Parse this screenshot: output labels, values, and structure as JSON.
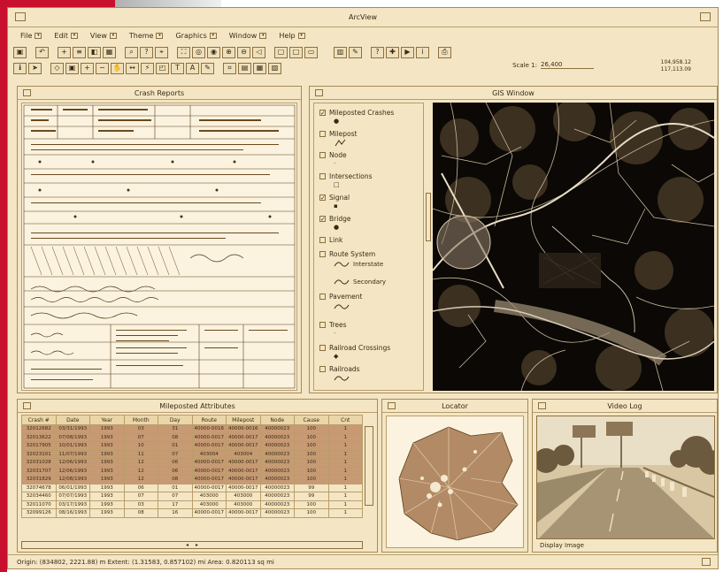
{
  "app": {
    "title": "ArcView",
    "menus": [
      "File",
      "Edit",
      "View",
      "Theme",
      "Graphics",
      "Window",
      "Help"
    ],
    "zoom_label": "Scale 1:",
    "zoom_value": "26,400",
    "coords_line1": "104,958.12",
    "coords_line2": "117,113.09"
  },
  "crash_panel": {
    "title": "Crash Reports"
  },
  "gis_panel": {
    "title": "GIS Window",
    "legend": [
      {
        "label": "Mileposted Crashes",
        "checked": true
      },
      {
        "label": "Milepost",
        "checked": false
      },
      {
        "label": "Node",
        "checked": false
      },
      {
        "label": "Intersections",
        "checked": false
      },
      {
        "label": "Signal",
        "checked": true
      },
      {
        "label": "Bridge",
        "checked": true
      },
      {
        "label": "Link",
        "checked": false
      },
      {
        "label": "Route System",
        "checked": false
      },
      {
        "label": "Interstate",
        "checked": false
      },
      {
        "label": "Secondary",
        "checked": false
      },
      {
        "label": "Pavement",
        "checked": false
      },
      {
        "label": "Trees",
        "checked": false
      },
      {
        "label": "Railroad Crossings",
        "checked": false
      },
      {
        "label": "Railroads",
        "checked": false
      }
    ]
  },
  "attributes_panel": {
    "title": "Mileposted Attributes",
    "columns": [
      "Crash #",
      "Date",
      "Year",
      "Month",
      "Day",
      "Route",
      "Milepost",
      "Node",
      "Cause",
      "Cnt"
    ],
    "rows": [
      [
        "32012682",
        "03/31/1993",
        "1993",
        "03",
        "31",
        "40000-0016",
        "40000-0016",
        "40000023",
        "100",
        "1"
      ],
      [
        "32013622",
        "07/08/1993",
        "1993",
        "07",
        "08",
        "40000-0017",
        "40000-0017",
        "40000023",
        "100",
        "1"
      ],
      [
        "32017905",
        "10/01/1993",
        "1993",
        "10",
        "01",
        "40000-0017",
        "40000-0017",
        "40000023",
        "100",
        "1"
      ],
      [
        "32023101",
        "11/07/1993",
        "1993",
        "11",
        "07",
        "403004",
        "403004",
        "40000023",
        "100",
        "1"
      ],
      [
        "32031028",
        "12/06/1993",
        "1993",
        "12",
        "06",
        "40000-0017",
        "40000-0017",
        "40000023",
        "100",
        "1"
      ],
      [
        "32031707",
        "12/06/1993",
        "1993",
        "12",
        "06",
        "40000-0017",
        "40000-0017",
        "40000023",
        "100",
        "1"
      ],
      [
        "32031829",
        "12/08/1993",
        "1993",
        "12",
        "08",
        "40000-0017",
        "40000-0017",
        "40000023",
        "100",
        "1"
      ],
      [
        "32074678",
        "06/01/1993",
        "1993",
        "06",
        "01",
        "40000-0017",
        "40000-0017",
        "40000023",
        "99",
        "1"
      ],
      [
        "32034460",
        "07/07/1993",
        "1993",
        "07",
        "07",
        "403000",
        "403000",
        "40000023",
        "99",
        "1"
      ],
      [
        "32011070",
        "03/17/1993",
        "1993",
        "03",
        "17",
        "403000",
        "403000",
        "40000023",
        "100",
        "1"
      ],
      [
        "32099126",
        "08/16/1993",
        "1993",
        "08",
        "16",
        "40000-0017",
        "40000-0017",
        "40000023",
        "100",
        "1"
      ]
    ],
    "highlighted_rows": [
      0,
      1,
      2,
      3,
      4,
      5,
      6
    ]
  },
  "locator_panel": {
    "title": "Locator"
  },
  "video_panel": {
    "title": "Video Log",
    "caption": "Display Image"
  },
  "status": "Origin: (834802, 2221.88) m  Extent: (1.31583, 0.857102) mi  Area: 0.820113 sq mi",
  "colors": {
    "panel_bg": "#f4e6c4",
    "border": "#a58a5a",
    "highlight": "#c79a74",
    "map_bg": "#0b0805",
    "accent": "#c8102e"
  }
}
